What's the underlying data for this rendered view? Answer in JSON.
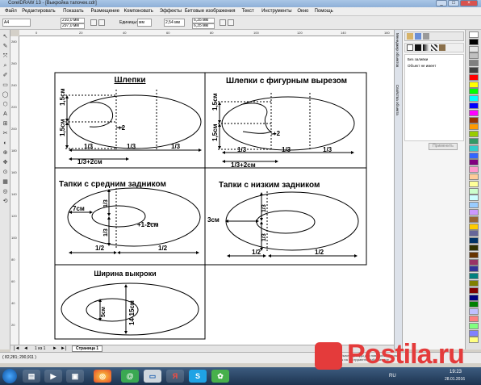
{
  "window": {
    "title": "CorelDRAW 13 - [Выкройка тапочек.cdr]"
  },
  "menu": [
    "Файл",
    "Редактировать",
    "Показать",
    "Размещение",
    "Компоновать",
    "Эффекты",
    "Битовые изображения",
    "Текст",
    "Инструменты",
    "Окно",
    "Помощь"
  ],
  "toolbar": {
    "page_size": "A4",
    "width": "210,0 мм",
    "height": "297,0 мм",
    "units_label": "Единицы:",
    "units": "мм",
    "nudge": "2,54 мм",
    "dup_x": "6,35 мм",
    "dup_y": "6,35 мм"
  },
  "ruler": {
    "h_ticks": [
      "0",
      "20",
      "40",
      "60",
      "80",
      "100",
      "120",
      "140",
      "160"
    ],
    "v_ticks": [
      "280",
      "260",
      "240",
      "220",
      "200",
      "180",
      "160",
      "140",
      "120",
      "100",
      "80",
      "60",
      "40",
      "20"
    ],
    "h_unit": "миллиметры"
  },
  "drawing": {
    "p1": {
      "title": "Шлепки",
      "v1": "1,5см",
      "v2": "1,5см",
      "plus": "+2",
      "third1": "1/3",
      "third2": "1/3",
      "third3": "1/3",
      "sum": "1/3+2см"
    },
    "p2": {
      "title": "Шлепки с фигурным вырезом",
      "v1": "1,5см",
      "v2": "1,5см",
      "plus": "+2",
      "third1": "1/3",
      "third2": "1/3",
      "third3": "1/3",
      "sum": "1/3+2см"
    },
    "p3": {
      "title": "Тапки с средним задником",
      "w": "7см",
      "plus": "+1-2см",
      "v1": "1/3",
      "v2": "1/3",
      "half1": "1/2",
      "half2": "1/2"
    },
    "p4": {
      "title": "Тапки с низким задником",
      "w": "3см",
      "v1": "1/3",
      "v2": "1/3",
      "half1": "1/2",
      "half2": "1/2"
    },
    "p5": {
      "title": "Ширина выкроки",
      "v1": "5см",
      "v2": "14-15см"
    }
  },
  "docker": {
    "item1": "Без заливки",
    "item2": "Объект не имеет",
    "apply": "Применить"
  },
  "docker_tabs": [
    "Менеджер объектов",
    "Свойства объекта"
  ],
  "pagebar": {
    "count": "1 из 1",
    "page": "Страница 1"
  },
  "status": {
    "coords": "( 82,281; 290,911 )",
    "hint": "Щелкните на объекте дважды для поворота/наклона; двойной щелчок на инструменте выбирает все объекты; Shift+щелчок"
  },
  "taskbar": {
    "lang": "RU",
    "time": "19:23",
    "date": "28.01.2016"
  },
  "watermark": {
    "text": "Postila.ru"
  },
  "palette": [
    "#ffffff",
    "#000000",
    "#e5e5e5",
    "#c0c0c0",
    "#808080",
    "#404040",
    "#ff0000",
    "#ffff00",
    "#00ff00",
    "#00ffff",
    "#0000ff",
    "#ff00ff",
    "#993300",
    "#ff9900",
    "#99cc00",
    "#339966",
    "#33cccc",
    "#3366ff",
    "#800080",
    "#ff99cc",
    "#ffcc99",
    "#ffff99",
    "#ccffcc",
    "#ccffff",
    "#99ccff",
    "#cc99ff",
    "#996633",
    "#ffcc00",
    "#666699",
    "#003366",
    "#333300",
    "#663300",
    "#993366",
    "#333399",
    "#008080",
    "#808000",
    "#800000",
    "#000080",
    "#008000",
    "#c0c0ff",
    "#ff8080",
    "#80ff80",
    "#8080ff",
    "#ffff80"
  ]
}
